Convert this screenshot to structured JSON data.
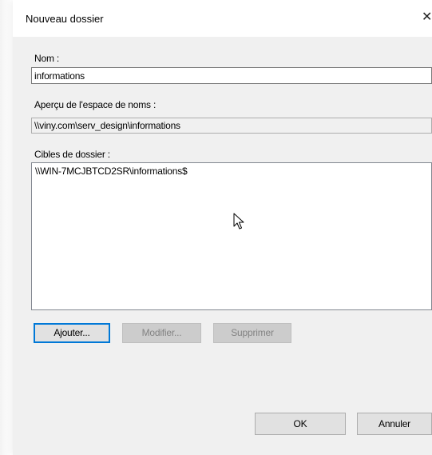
{
  "dialog": {
    "title": "Nouveau dossier",
    "close_glyph": "✕"
  },
  "name_field": {
    "label": "Nom :",
    "value": "informations"
  },
  "namespace_preview": {
    "label": "Aperçu de l'espace de noms :",
    "value": "\\\\viny.com\\serv_design\\informations"
  },
  "targets": {
    "label": "Cibles de dossier :",
    "items": [
      "\\\\WIN-7MCJBTCD2SR\\informations$"
    ]
  },
  "actions": {
    "add": "Ajouter...",
    "modify": "Modifier...",
    "delete": "Supprimer"
  },
  "footer": {
    "ok": "OK",
    "cancel": "Annuler"
  },
  "colors": {
    "accent": "#0078d7",
    "panel": "#f0f0f0"
  },
  "cursor": {
    "icon": "mouse-pointer-icon"
  }
}
